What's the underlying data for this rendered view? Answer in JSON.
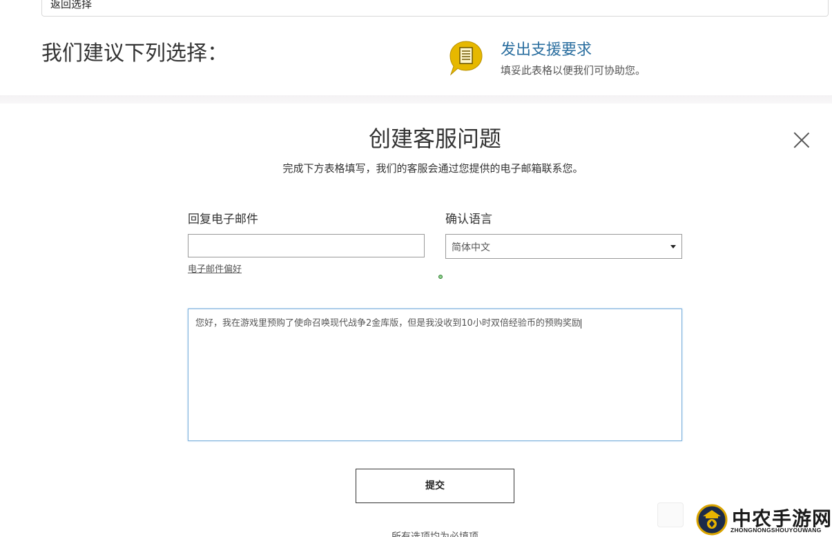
{
  "top": {
    "back_label": "返回选择"
  },
  "suggestion": {
    "title": "我们建议下列选择：",
    "support_link": "发出支援要求",
    "support_desc": "填妥此表格以便我们可协助您。"
  },
  "modal": {
    "title": "创建客服问题",
    "subtitle": "完成下方表格填写，我们的客服会通过您提供的电子邮箱联系您。",
    "email_label": "回复电子邮件",
    "email_value": "",
    "email_pref_link": "电子邮件偏好",
    "language_label": "确认语言",
    "language_value": "简体中文",
    "message_text": "您好，我在游戏里预购了使命召唤现代战争2金库版，但是我没收到10小时双倍经验币的预购奖励",
    "submit_label": "提交",
    "required_note": "所有选项均为必填项"
  },
  "watermark": {
    "title": "中农手游网",
    "subtitle": "ZHONGNONGSHOUYOUWANG"
  },
  "colors": {
    "link": "#2a6e9f",
    "icon_gold": "#e5b800",
    "focus_border": "#7fb2dd"
  }
}
